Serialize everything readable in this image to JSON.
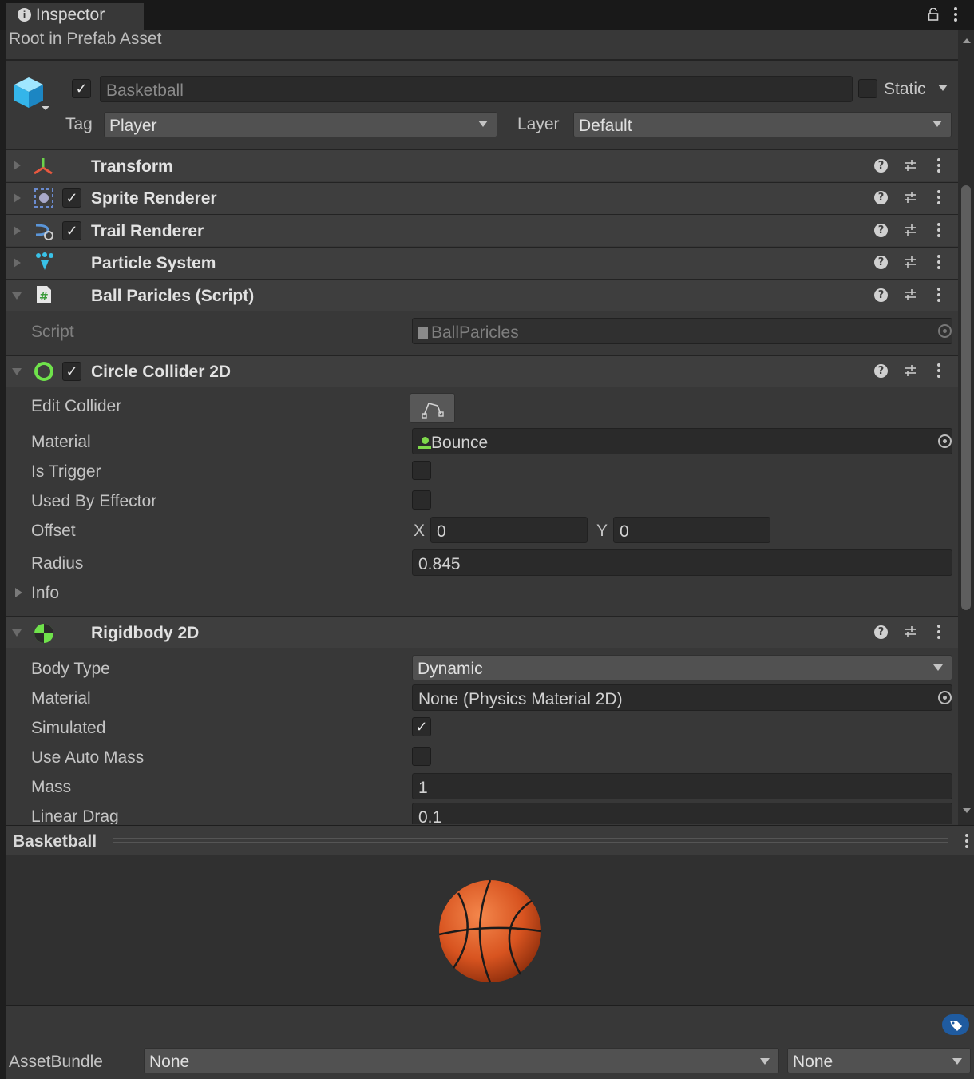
{
  "tab": {
    "title": "Inspector"
  },
  "header": {
    "subtitle": "Root in Prefab Asset",
    "object_name": "Basketball",
    "static_label": "Static",
    "tag_label": "Tag",
    "tag_value": "Player",
    "layer_label": "Layer",
    "layer_value": "Default"
  },
  "components": {
    "transform": "Transform",
    "sprite_renderer": "Sprite Renderer",
    "trail_renderer": "Trail Renderer",
    "particle_system": "Particle System",
    "ball_script": "Ball Paricles (Script)",
    "circle_collider": "Circle Collider 2D",
    "rigidbody": "Rigidbody 2D"
  },
  "script_section": {
    "label": "Script",
    "value": "BallParicles"
  },
  "collider": {
    "edit_label": "Edit Collider",
    "material_label": "Material",
    "material_value": "Bounce",
    "trigger_label": "Is Trigger",
    "effector_label": "Used By Effector",
    "offset_label": "Offset",
    "offset_x_label": "X",
    "offset_x": "0",
    "offset_y_label": "Y",
    "offset_y": "0",
    "radius_label": "Radius",
    "radius": "0.845",
    "info_label": "Info"
  },
  "rigidbody": {
    "body_type_label": "Body Type",
    "body_type": "Dynamic",
    "material_label": "Material",
    "material_value": "None (Physics Material 2D)",
    "simulated_label": "Simulated",
    "auto_mass_label": "Use Auto Mass",
    "mass_label": "Mass",
    "mass": "1",
    "linear_drag_label": "Linear Drag",
    "linear_drag": "0.1"
  },
  "preview": {
    "title": "Basketball"
  },
  "assetbundle": {
    "label": "AssetBundle",
    "name": "None",
    "variant": "None"
  },
  "icons": [
    "info-icon",
    "lock-icon",
    "kebab-icon",
    "cube-icon",
    "help-icon",
    "presets-icon",
    "target-icon",
    "tag-icon"
  ]
}
